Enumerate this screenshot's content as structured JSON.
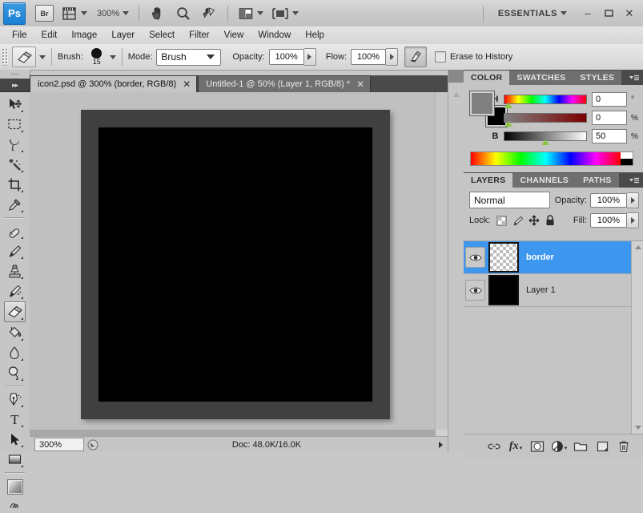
{
  "app": {
    "name": "Adobe Photoshop",
    "logo_text": "Ps",
    "bridge_label": "Br",
    "zoom_level": "300%",
    "workspace": "ESSENTIALS",
    "window_buttons": {
      "minimize": "–",
      "maximize": "❑",
      "close": "✕"
    }
  },
  "menubar": {
    "items": [
      {
        "label": "File"
      },
      {
        "label": "Edit"
      },
      {
        "label": "Image"
      },
      {
        "label": "Layer"
      },
      {
        "label": "Select"
      },
      {
        "label": "Filter"
      },
      {
        "label": "View"
      },
      {
        "label": "Window"
      },
      {
        "label": "Help"
      }
    ]
  },
  "options_bar": {
    "tool": "eraser-tool",
    "brush_label": "Brush:",
    "brush_size": "15",
    "mode_label": "Mode:",
    "mode_value": "Brush",
    "opacity_label": "Opacity:",
    "opacity_value": "100%",
    "flow_label": "Flow:",
    "flow_value": "100%",
    "airbrush_name": "airbrush-toggle",
    "erase_to_history_label": "Erase to History",
    "erase_to_history_checked": false
  },
  "tools": {
    "collapse_label": "▸▸",
    "items": [
      {
        "name": "move-tool",
        "selected": false
      },
      {
        "name": "rectangular-marquee-tool",
        "selected": false
      },
      {
        "name": "lasso-tool",
        "selected": false
      },
      {
        "name": "magic-wand-tool",
        "selected": false
      },
      {
        "name": "crop-tool",
        "selected": false
      },
      {
        "name": "eyedropper-tool",
        "selected": false
      },
      {
        "name": "spot-healing-brush-tool",
        "selected": false
      },
      {
        "name": "brush-tool",
        "selected": false
      },
      {
        "name": "clone-stamp-tool",
        "selected": false
      },
      {
        "name": "history-brush-tool",
        "selected": false
      },
      {
        "name": "eraser-tool",
        "selected": true
      },
      {
        "name": "paint-bucket-tool",
        "selected": false
      },
      {
        "name": "blur-tool",
        "selected": false
      },
      {
        "name": "dodge-tool",
        "selected": false
      },
      {
        "name": "pen-tool",
        "selected": false
      },
      {
        "name": "horizontal-type-tool",
        "selected": false,
        "glyph": "T"
      },
      {
        "name": "path-selection-tool",
        "selected": false
      },
      {
        "name": "gradient-tool",
        "selected": false
      }
    ]
  },
  "document_tabs": [
    {
      "label": "icon2.psd @ 300% (border, RGB/8)",
      "active": true,
      "close": "✕"
    },
    {
      "label": "Untitled-1 @ 50% (Layer 1, RGB/8) *",
      "active": false,
      "close": "✕"
    }
  ],
  "canvas": {
    "border_color": "#404040",
    "fill_color": "#000000",
    "background_color": "#c0c0c0"
  },
  "status_bar": {
    "zoom": "300%",
    "doc_info": "Doc: 48.0K/16.0K",
    "more_arrow": "▶"
  },
  "color_panel": {
    "tabs": [
      {
        "label": "COLOR",
        "active": true
      },
      {
        "label": "SWATCHES",
        "active": false
      },
      {
        "label": "STYLES",
        "active": false
      }
    ],
    "foreground": "#808080",
    "background": "#000000",
    "sliders": [
      {
        "channel": "H",
        "value": "0",
        "unit": "°",
        "pos_pct": 4
      },
      {
        "channel": "S",
        "value": "0",
        "unit": "%",
        "pos_pct": 4
      },
      {
        "channel": "B",
        "value": "50",
        "unit": "%",
        "pos_pct": 50
      }
    ]
  },
  "layers_panel": {
    "tabs": [
      {
        "label": "LAYERS",
        "active": true
      },
      {
        "label": "CHANNELS",
        "active": false
      },
      {
        "label": "PATHS",
        "active": false
      }
    ],
    "blend_mode": "Normal",
    "opacity_label": "Opacity:",
    "opacity_value": "100%",
    "lock_label": "Lock:",
    "fill_label": "Fill:",
    "fill_value": "100%",
    "lock_icons": [
      "lock-transparent-pixels-icon",
      "lock-image-pixels-icon",
      "lock-position-icon",
      "lock-all-icon"
    ],
    "layers": [
      {
        "name": "border",
        "visible": true,
        "selected": true,
        "thumb": "checker"
      },
      {
        "name": "Layer 1",
        "visible": true,
        "selected": false,
        "thumb": "black"
      }
    ],
    "footer_icons": [
      "link-layers-icon",
      "layer-style-fx-icon",
      "add-layer-mask-icon",
      "new-adjustment-layer-icon",
      "new-group-icon",
      "new-layer-icon",
      "delete-layer-icon"
    ],
    "fx_label": "fx"
  }
}
